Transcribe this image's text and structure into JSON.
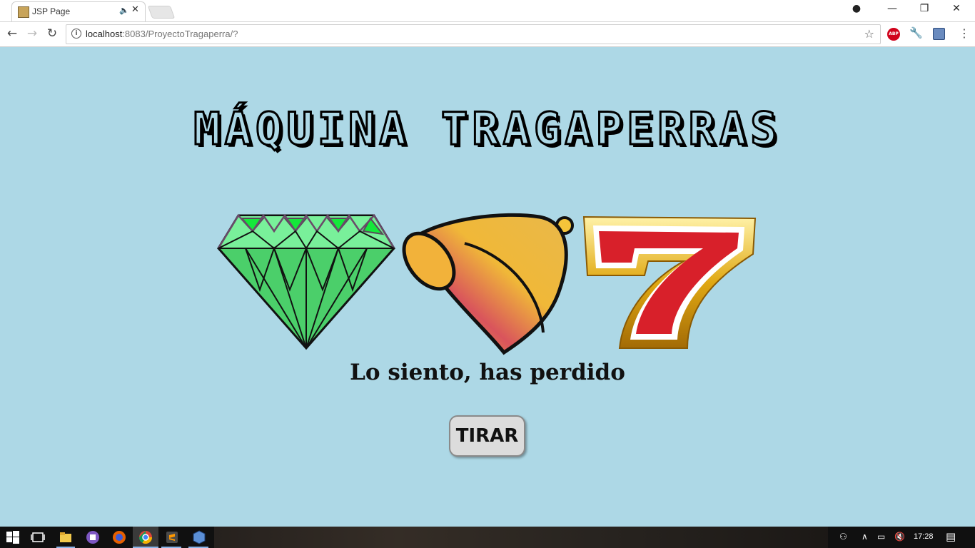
{
  "browser": {
    "tab_title": "JSP Page",
    "url_host": "localhost",
    "url_rest": ":8083/ProyectoTragaperra/?"
  },
  "page": {
    "title": "MÁQUINA TRAGAPERRAS",
    "reels": [
      "diamond",
      "bell",
      "seven"
    ],
    "result_message": "Lo siento, has perdido",
    "spin_button_label": "TIRAR",
    "background_color": "#add8e6"
  },
  "taskbar": {
    "clock": "17:28",
    "pinned_apps": [
      "file-explorer",
      "pomodoro-app",
      "firefox",
      "chrome",
      "sublime-text",
      "virtualbox"
    ]
  }
}
